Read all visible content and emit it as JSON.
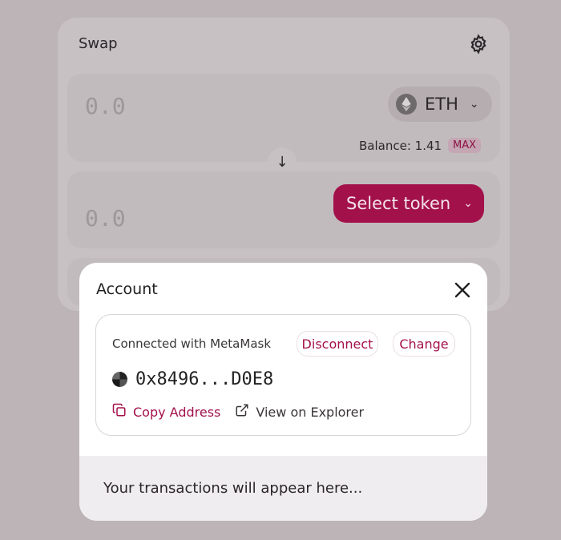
{
  "swap": {
    "title": "Swap",
    "input_amount": "0.0",
    "input_token": "ETH",
    "balance_label": "Balance: 1.41",
    "max_label": "MAX",
    "output_amount": "0.0",
    "select_token_label": "Select token"
  },
  "account_modal": {
    "title": "Account",
    "connected_text": "Connected with MetaMask",
    "disconnect_label": "Disconnect",
    "change_label": "Change",
    "address": "0x8496...D0E8",
    "copy_address_label": "Copy Address",
    "view_explorer_label": "View on Explorer",
    "transactions_placeholder": "Your transactions will appear here..."
  },
  "colors": {
    "accent": "#a3114a",
    "overlay": "#bcb4b7",
    "modal_bg": "#ffffff",
    "footer_bg": "#efedef"
  },
  "icons": [
    "gear-icon",
    "eth-icon",
    "chevron-down-icon",
    "arrow-down-icon",
    "close-icon",
    "identicon",
    "copy-icon",
    "external-link-icon"
  ]
}
